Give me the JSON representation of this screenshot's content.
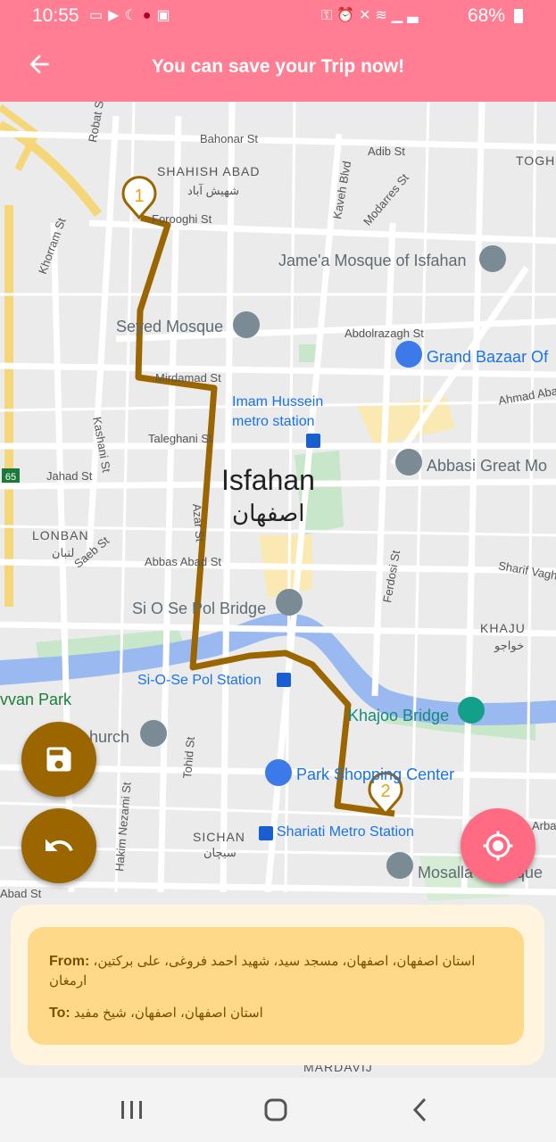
{
  "status": {
    "time": "10:55",
    "battery": "68%",
    "icons_left": [
      "voicemail-icon",
      "youtube-icon",
      "app-icon",
      "location-icon",
      "gallery-icon"
    ],
    "icons_right": [
      "key-icon",
      "alarm-icon",
      "mute-icon",
      "wifi-icon",
      "signal-icon",
      "battery-icon"
    ]
  },
  "app_bar": {
    "title": "You can save your Trip now!",
    "back_icon": "arrow-back-icon",
    "color": "#ff7e93"
  },
  "map": {
    "streets": [
      "Bahonar St",
      "Adib St",
      "Robat St",
      "Forooghi St",
      "Khorram St",
      "Kaveh Blvd",
      "Modarres St",
      "Mirdamad St",
      "Kashani St",
      "Abdolrazagh St",
      "Ahmad Aba",
      "Taleghani St",
      "Jahad St",
      "Azar St",
      "Abbas Abad St",
      "Saeb St",
      "Sharif Vagh",
      "Ferdosi St",
      "Tohid St",
      "Hakim Nezami St",
      "Abad St"
    ],
    "areas": [
      "SHAHISH ABAD",
      "TOGH",
      "LONBAN",
      "KHAJU",
      "SICHAN",
      "MARDAVIJ"
    ],
    "areas_fa": [
      "شهیش آباد",
      "لنبان",
      "خواجو",
      "سیچان"
    ],
    "city": "Isfahan",
    "city_fa": "اصفهان",
    "pois": {
      "mosque_jame": "Jame'a Mosque of Isfahan",
      "seyed_mosque": "Seyed Mosque",
      "grand_bazaar": "Grand Bazaar Of",
      "imam_hussein_1": "Imam Hussein",
      "imam_hussein_2": "metro station",
      "abbasi": "Abbasi Great Mo",
      "siosepol_bridge": "Si O Se Pol Bridge",
      "siosepol_station": "Si-O-Se Pol Station",
      "khajoo_bridge": "Khajoo Bridge",
      "park_shopping": "Park Shopping Center",
      "shariati_station": "Shariati Metro Station",
      "park": "vvan Park",
      "church": "hurch",
      "mosalla": "Mosalla",
      "mosque_suffix": "que",
      "arbab": "Arba"
    },
    "route_color": "#9b6600",
    "markers": [
      "1",
      "2"
    ],
    "highway": "65"
  },
  "fabs": {
    "save_icon": "save-icon",
    "undo_icon": "undo-icon",
    "locate_icon": "my-location-icon",
    "save_color": "#9b6600",
    "locate_color": "#ff6b83"
  },
  "trip": {
    "from_label": "From:",
    "from_value": "استان اصفهان، اصفهان، مسجد سید، شهید احمد فروغی، علی برکتین، ارمغان",
    "to_label": "To:",
    "to_value": "استان اصفهان، اصفهان، شیخ مفید"
  },
  "nav": {
    "recents_icon": "recents-icon",
    "home_icon": "home-icon",
    "back_icon": "back-icon"
  }
}
